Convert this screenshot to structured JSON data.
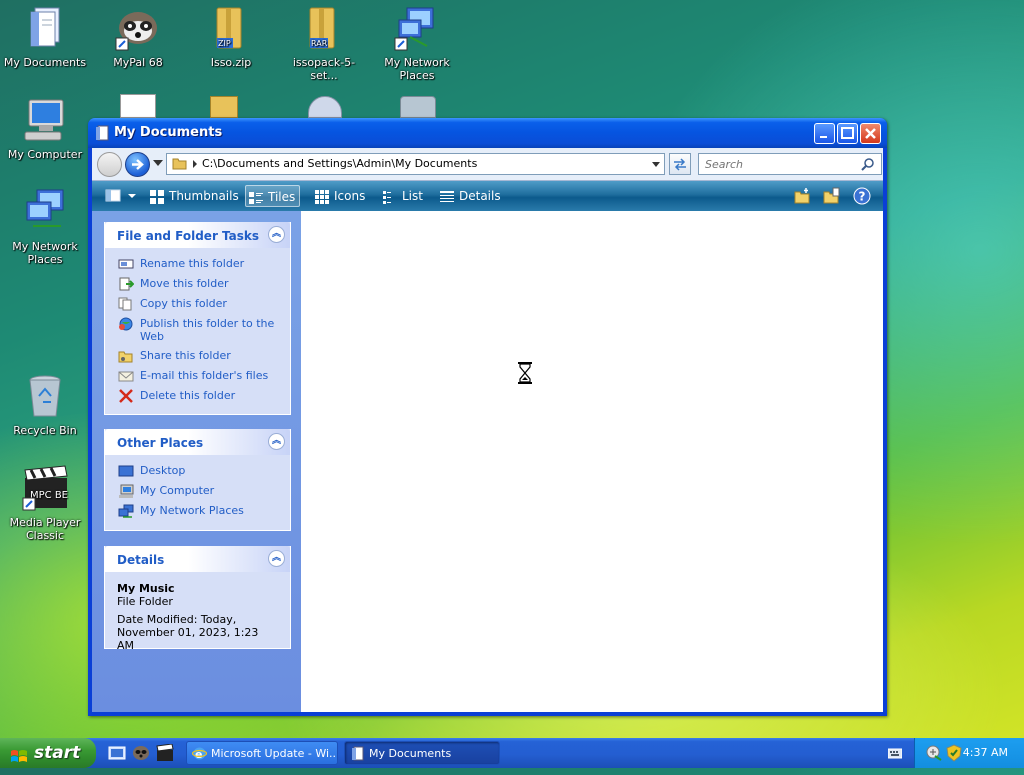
{
  "desktop": {
    "icons": [
      {
        "label": "My Documents"
      },
      {
        "label": "MyPal 68"
      },
      {
        "label": "Isso.zip"
      },
      {
        "label": "issopack-5-set..."
      },
      {
        "label": "My Network Places"
      },
      {
        "label": "My Computer"
      },
      {
        "label": "My Network Places"
      },
      {
        "label": "Recycle Bin"
      },
      {
        "label": "Media Player Classic"
      }
    ]
  },
  "window": {
    "title": "My Documents",
    "address": {
      "path": "C:\\Documents and Settings\\Admin\\My Documents"
    },
    "search": {
      "placeholder": "Search"
    },
    "toolbar": {
      "thumbnails": "Thumbnails",
      "tiles": "Tiles",
      "icons": "Icons",
      "list": "List",
      "details": "Details"
    },
    "tasks_panel": {
      "title": "File and Folder Tasks",
      "items": [
        "Rename this folder",
        "Move this folder",
        "Copy this folder",
        "Publish this folder to the Web",
        "Share this folder",
        "E-mail this folder's files",
        "Delete this folder"
      ]
    },
    "other_places": {
      "title": "Other Places",
      "items": [
        "Desktop",
        "My Computer",
        "My Network Places"
      ]
    },
    "details_panel": {
      "title": "Details",
      "name": "My Music",
      "type": "File Folder",
      "modified": "Date Modified: Today, November 01, 2023, 1:23 AM"
    }
  },
  "taskbar": {
    "start": "start",
    "tasks": [
      "Microsoft Update - Wi...",
      "My Documents"
    ],
    "clock": "4:37 AM"
  },
  "colors": {
    "link": "#215dc6",
    "titlebar": "#0a5fea",
    "taskbar": "#245ed1"
  }
}
